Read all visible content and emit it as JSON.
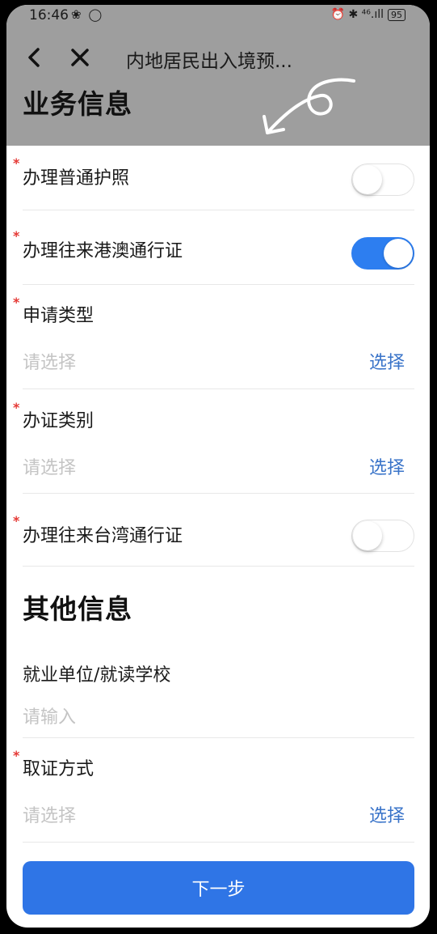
{
  "status_bar": {
    "time": "16:46",
    "left_icons": "❀ ◯",
    "right_icons": "⏰ ✱ ⁴⁶.ıll",
    "battery": "95"
  },
  "nav": {
    "title": "内地居民出入境预..."
  },
  "sections": {
    "business": "业务信息",
    "other": "其他信息"
  },
  "fields": {
    "passport": {
      "label": "办理普通护照",
      "required": "*",
      "enabled": false
    },
    "hk_macau": {
      "label": "办理往来港澳通行证",
      "required": "*",
      "enabled": true
    },
    "apply_type": {
      "label": "申请类型",
      "required": "*",
      "placeholder": "请选择",
      "action": "选择"
    },
    "cert_category": {
      "label": "办证类别",
      "required": "*",
      "placeholder": "请选择",
      "action": "选择"
    },
    "taiwan": {
      "label": "办理往来台湾通行证",
      "required": "*",
      "enabled": false
    },
    "employer": {
      "label": "就业单位/就读学校",
      "placeholder": "请输入"
    },
    "pickup": {
      "label": "取证方式",
      "required": "*",
      "placeholder": "请选择",
      "action": "选择"
    }
  },
  "footer": {
    "next_label": "下一步"
  },
  "colors": {
    "accent": "#2f75e6",
    "toggle_on": "#2d7ef0",
    "link": "#3a74c9",
    "required": "#e53935",
    "header_bg": "#9e9e9e"
  }
}
